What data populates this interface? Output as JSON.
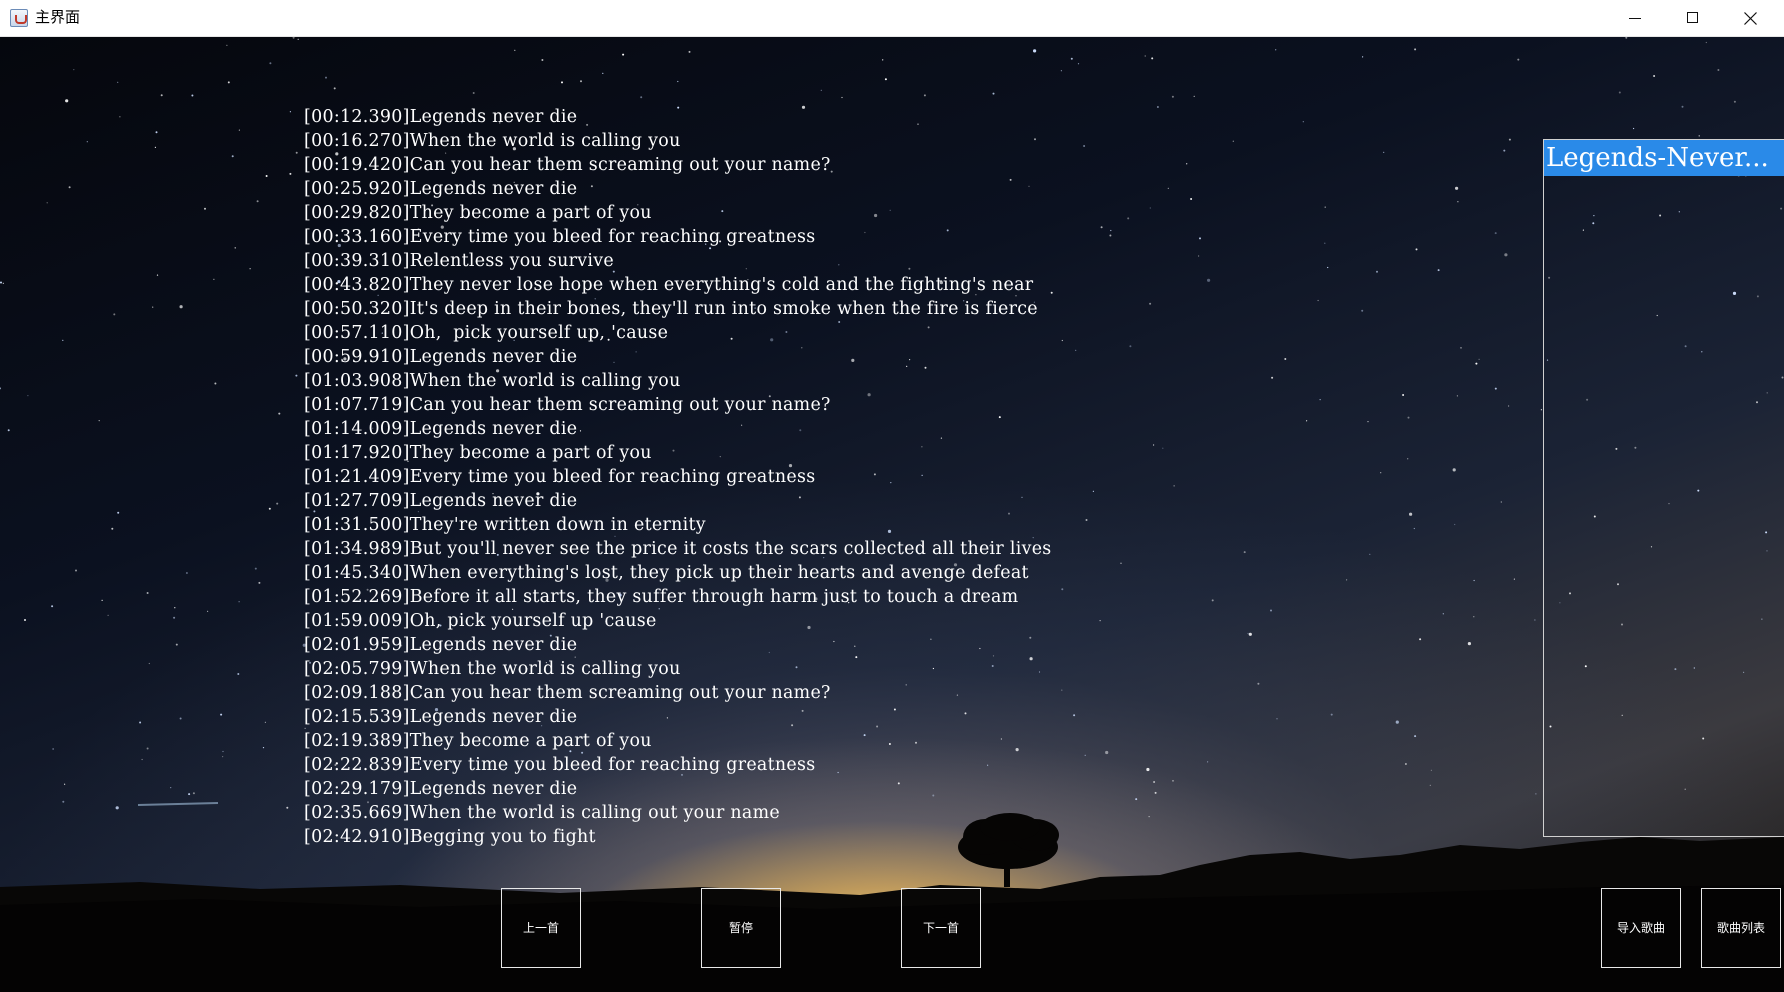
{
  "window": {
    "title": "主界面",
    "app_icon": "java-cup-icon",
    "controls": [
      "minimize-icon",
      "maximize-icon",
      "close-icon"
    ]
  },
  "lyrics": [
    "[00:12.390]Legends never die",
    "[00:16.270]When the world is calling you",
    "[00:19.420]Can you hear them screaming out your name?",
    "[00:25.920]Legends never die",
    "[00:29.820]They become a part of you",
    "[00:33.160]Every time you bleed for reaching greatness",
    "[00:39.310]Relentless you survive",
    "[00:43.820]They never lose hope when everything's cold and the fighting's near",
    "[00:50.320]It's deep in their bones, they'll run into smoke when the fire is fierce",
    "[00:57.110]Oh,  pick yourself up, 'cause",
    "[00:59.910]Legends never die",
    "[01:03.908]When the world is calling you",
    "[01:07.719]Can you hear them screaming out your name?",
    "[01:14.009]Legends never die",
    "[01:17.920]They become a part of you",
    "[01:21.409]Every time you bleed for reaching greatness",
    "[01:27.709]Legends never die",
    "[01:31.500]They're written down in eternity",
    "[01:34.989]But you'll never see the price it costs the scars collected all their lives",
    "[01:45.340]When everything's lost, they pick up their hearts and avenge defeat",
    "[01:52.269]Before it all starts, they suffer through harm just to touch a dream",
    "[01:59.009]Oh, pick yourself up 'cause",
    "[02:01.959]Legends never die",
    "[02:05.799]When the world is calling you",
    "[02:09.188]Can you hear them screaming out your name?",
    "[02:15.539]Legends never die",
    "[02:19.389]They become a part of you",
    "[02:22.839]Every time you bleed for reaching greatness",
    "[02:29.179]Legends never die",
    "[02:35.669]When the world is calling out your name",
    "[02:42.910]Begging you to fight"
  ],
  "playlist": {
    "items": [
      {
        "label": "Legends-Never...",
        "selected": true
      }
    ],
    "selected_color": "#2a8ae8"
  },
  "controls": {
    "prev_label": "上一首",
    "pause_label": "暂停",
    "next_label": "下一首",
    "import_label": "导入歌曲",
    "list_label": "歌曲列表"
  }
}
